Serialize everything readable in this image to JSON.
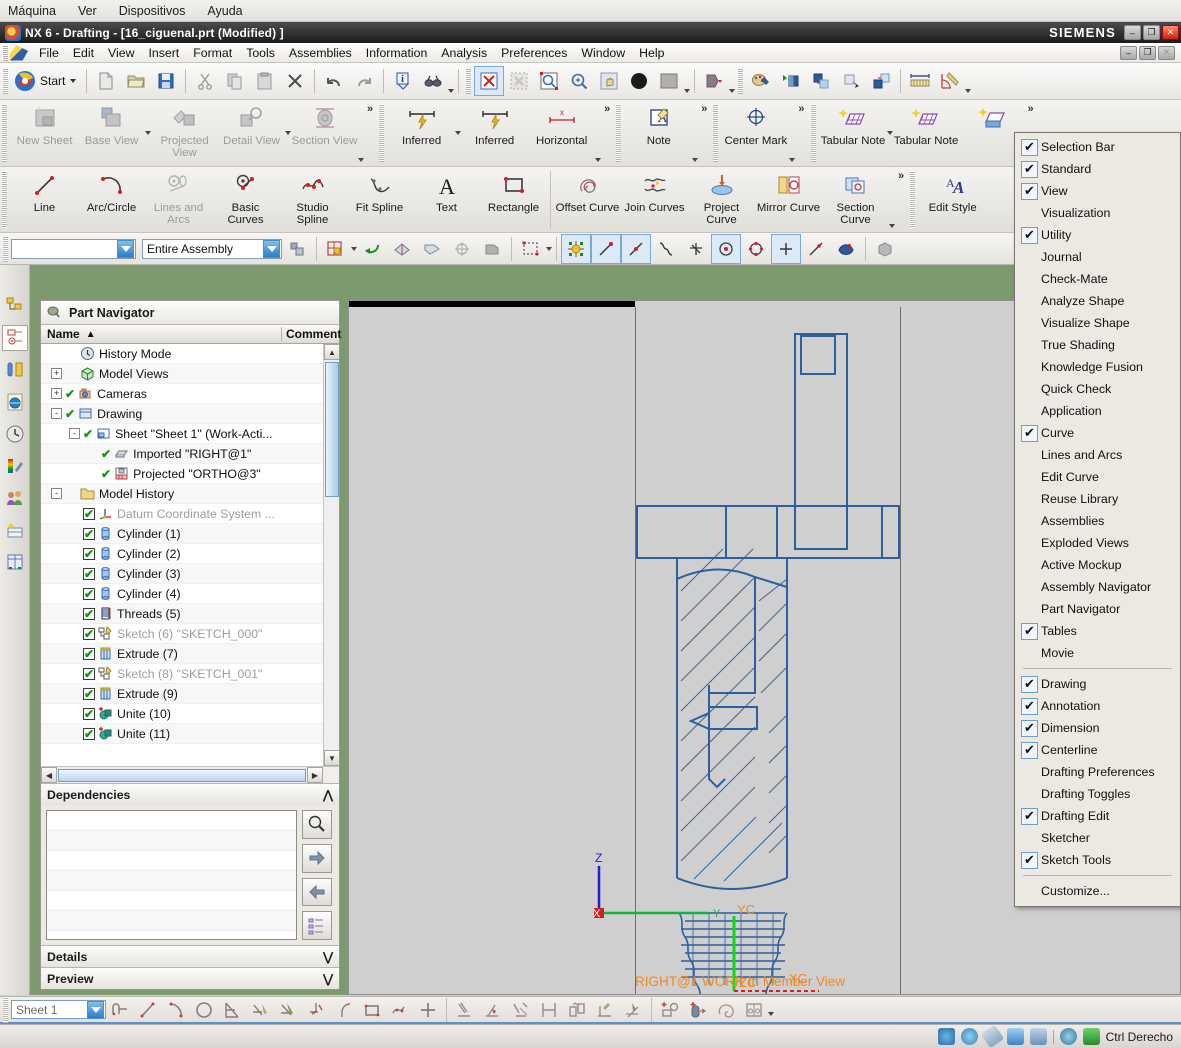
{
  "host": {
    "menus": [
      "Máquina",
      "Ver",
      "Dispositivos",
      "Ayuda"
    ],
    "status_text": "Ctrl Derecho",
    "status_icons": [
      "disk-icon",
      "cd-icon",
      "usb-icon",
      "folder-icon",
      "display-icon",
      "network-icon",
      "download-icon"
    ]
  },
  "window": {
    "title": "NX 6 - Drafting - [16_ciguenal.prt (Modified) ]",
    "brand": "SIEMENS",
    "buttons": {
      "minimize": "–",
      "restore": "❐",
      "close": "✕"
    },
    "doc_buttons": {
      "minimize": "–",
      "restore": "❐",
      "close": "✕"
    }
  },
  "menubar": {
    "items": [
      "File",
      "Edit",
      "View",
      "Insert",
      "Format",
      "Tools",
      "Assemblies",
      "Information",
      "Analysis",
      "Preferences",
      "Window",
      "Help"
    ]
  },
  "standard_toolbar": {
    "start_label": "Start",
    "buttons": [
      "start-button",
      "new-icon",
      "open-icon",
      "save-icon",
      "cut-icon",
      "copy-icon",
      "paste-icon",
      "delete-icon",
      "undo-icon",
      "redo-icon",
      "information-icon",
      "analysis-icon",
      "fit-view-icon",
      "zoom-window-icon",
      "zoom-area-icon",
      "zoom-icon",
      "pan-icon",
      "rotate-icon",
      "shading-icon",
      "hide-icon",
      "palette-icon",
      "layer-visible-icon",
      "layer-settings-icon",
      "move-to-layer-icon",
      "copy-to-layer-icon",
      "linear-dimension-icon",
      "angular-dimension-icon"
    ]
  },
  "ribbon": {
    "drawing_group": [
      {
        "label": "New Sheet",
        "icon": "new-sheet-icon",
        "disabled": true
      },
      {
        "label": "Base View",
        "icon": "base-view-icon",
        "disabled": true
      },
      {
        "label": "Projected View",
        "icon": "projected-view-icon",
        "disabled": true
      },
      {
        "label": "Detail View",
        "icon": "detail-view-icon",
        "disabled": true
      },
      {
        "label": "Section View",
        "icon": "section-view-icon",
        "disabled": true
      }
    ],
    "dimension_group": [
      {
        "label": "Inferred",
        "icon": "inferred-dimension-icon",
        "disabled": false
      },
      {
        "label": "Inferred",
        "icon": "inferred-dimension-icon",
        "disabled": false
      },
      {
        "label": "Horizontal",
        "icon": "horizontal-dimension-icon",
        "disabled": false
      }
    ],
    "annotation_group": [
      {
        "label": "Note",
        "icon": "note-icon",
        "disabled": false
      }
    ],
    "centerline_group": [
      {
        "label": "Center Mark",
        "icon": "center-mark-icon",
        "disabled": false
      }
    ],
    "tables_group": [
      {
        "label": "Tabular Note",
        "icon": "tabular-note-icon",
        "disabled": false
      },
      {
        "label": "Tabular Note",
        "icon": "tabular-note-icon",
        "disabled": false
      },
      {
        "label": "",
        "icon": "table-insert-icon",
        "disabled": false
      }
    ],
    "curve_group": [
      {
        "label": "Line",
        "icon": "line-icon",
        "disabled": false
      },
      {
        "label": "Arc/Circle",
        "icon": "arc-circle-icon",
        "disabled": false
      },
      {
        "label": "Lines and Arcs",
        "icon": "lines-and-arcs-icon",
        "disabled": true
      },
      {
        "label": "Basic Curves",
        "icon": "basic-curves-icon",
        "disabled": false
      },
      {
        "label": "Studio Spline",
        "icon": "studio-spline-icon",
        "disabled": false
      },
      {
        "label": "Fit Spline",
        "icon": "fit-spline-icon",
        "disabled": false
      },
      {
        "label": "Text",
        "icon": "text-icon",
        "disabled": false
      },
      {
        "label": "Rectangle",
        "icon": "rectangle-icon",
        "disabled": false
      }
    ],
    "curve_group2": [
      {
        "label": "Offset Curve",
        "icon": "offset-curve-icon",
        "disabled": false
      },
      {
        "label": "Join Curves",
        "icon": "join-curves-icon",
        "disabled": false
      },
      {
        "label": "Project Curve",
        "icon": "project-curve-icon",
        "disabled": false
      },
      {
        "label": "Mirror Curve",
        "icon": "mirror-curve-icon",
        "disabled": false
      },
      {
        "label": "Section Curve",
        "icon": "section-curve-icon",
        "disabled": false
      }
    ],
    "edit_group": [
      {
        "label": "Edit Style",
        "icon": "edit-style-icon",
        "disabled": false
      }
    ],
    "overflow_symbol": "»"
  },
  "selection_bar": {
    "type_filter_value": "",
    "scope_value": "Entire Assembly",
    "icons": [
      "select-general-icon",
      "snap-point-icon",
      "back-icon",
      "faceted-icon",
      "face-icon",
      "feature-icon",
      "body-icon",
      "rectangle-select-icon",
      "snap-all-icon",
      "end-point-icon",
      "midpoint-icon",
      "control-point-icon",
      "intersection-icon",
      "arc-center-icon",
      "quadrant-icon",
      "existing-point-icon",
      "point-on-curve-icon",
      "point-on-face-icon",
      "bounding-box-icon"
    ]
  },
  "left_strip": {
    "buttons": [
      "assembly-navigator-icon",
      "part-navigator-icon",
      "reuse-library-icon",
      "internet-explorer-icon",
      "history-icon",
      "roles-icon",
      "system-scene-icon",
      "hd3d-tools-icon",
      "web-browser-icon"
    ]
  },
  "part_navigator": {
    "title": "Part Navigator",
    "title_icon": "part-navigator-icon",
    "columns": [
      "Name",
      "Comment"
    ],
    "sort_indicator": "▲",
    "rows": [
      {
        "label": "History Mode",
        "indent": 0,
        "icon": "clock-icon",
        "expander": "",
        "check": "none",
        "grey": false
      },
      {
        "label": "Model Views",
        "indent": 0,
        "icon": "model-views-icon",
        "expander": "+",
        "check": "none",
        "grey": false
      },
      {
        "label": "Cameras",
        "indent": 0,
        "icon": "camera-icon",
        "expander": "+",
        "check": "green",
        "grey": false
      },
      {
        "label": "Drawing",
        "indent": 0,
        "icon": "drawing-icon",
        "expander": "-",
        "check": "green",
        "grey": false
      },
      {
        "label": "Sheet \"Sheet 1\" (Work-Acti...",
        "indent": 1,
        "icon": "sheet-icon",
        "expander": "-",
        "check": "green",
        "grey": false
      },
      {
        "label": "Imported \"RIGHT@1\"",
        "indent": 2,
        "icon": "imported-view-icon",
        "expander": "",
        "check": "green",
        "grey": false
      },
      {
        "label": "Projected \"ORTHO@3\"",
        "indent": 2,
        "icon": "projected-view-icon",
        "expander": "",
        "check": "green",
        "grey": false
      },
      {
        "label": "Model History",
        "indent": 0,
        "icon": "folder-icon",
        "expander": "-",
        "check": "none",
        "grey": false
      },
      {
        "label": "Datum Coordinate System ...",
        "indent": 1,
        "icon": "datum-csys-icon",
        "expander": "",
        "check": "box",
        "grey": true
      },
      {
        "label": "Cylinder (1)",
        "indent": 1,
        "icon": "cylinder-icon",
        "expander": "",
        "check": "box",
        "grey": false
      },
      {
        "label": "Cylinder (2)",
        "indent": 1,
        "icon": "cylinder-icon",
        "expander": "",
        "check": "box",
        "grey": false
      },
      {
        "label": "Cylinder (3)",
        "indent": 1,
        "icon": "cylinder-icon",
        "expander": "",
        "check": "box",
        "grey": false
      },
      {
        "label": "Cylinder (4)",
        "indent": 1,
        "icon": "cylinder-icon",
        "expander": "",
        "check": "box",
        "grey": false
      },
      {
        "label": "Threads (5)",
        "indent": 1,
        "icon": "threads-icon",
        "expander": "",
        "check": "box",
        "grey": false
      },
      {
        "label": "Sketch (6) \"SKETCH_000\"",
        "indent": 1,
        "icon": "sketch-icon",
        "expander": "",
        "check": "box",
        "grey": true
      },
      {
        "label": "Extrude (7)",
        "indent": 1,
        "icon": "extrude-icon",
        "expander": "",
        "check": "box",
        "grey": false
      },
      {
        "label": "Sketch (8) \"SKETCH_001\"",
        "indent": 1,
        "icon": "sketch-icon",
        "expander": "",
        "check": "box",
        "grey": true
      },
      {
        "label": "Extrude (9)",
        "indent": 1,
        "icon": "extrude-icon",
        "expander": "",
        "check": "box",
        "grey": false
      },
      {
        "label": "Unite (10)",
        "indent": 1,
        "icon": "unite-icon",
        "expander": "",
        "check": "box",
        "grey": false
      },
      {
        "label": "Unite (11)",
        "indent": 1,
        "icon": "unite-icon",
        "expander": "",
        "check": "box",
        "grey": false
      }
    ],
    "sections": [
      {
        "title": "Dependencies",
        "state": "expanded",
        "chevron": "⋀"
      },
      {
        "title": "Details",
        "state": "collapsed",
        "chevron": "⋁"
      },
      {
        "title": "Preview",
        "state": "collapsed",
        "chevron": "⋁"
      }
    ],
    "dependency_buttons": [
      "search-icon",
      "forward-arrow-icon",
      "back-arrow-icon",
      "expand-tree-icon"
    ]
  },
  "toolbar_menu": {
    "items": [
      {
        "label": "Selection Bar",
        "checked": true
      },
      {
        "label": "Standard",
        "checked": true
      },
      {
        "label": "View",
        "checked": true
      },
      {
        "label": "Visualization",
        "checked": false
      },
      {
        "label": "Utility",
        "checked": true
      },
      {
        "label": "Journal",
        "checked": false
      },
      {
        "label": "Check-Mate",
        "checked": false
      },
      {
        "label": "Analyze Shape",
        "checked": false
      },
      {
        "label": "Visualize Shape",
        "checked": false
      },
      {
        "label": "True Shading",
        "checked": false
      },
      {
        "label": "Knowledge Fusion",
        "checked": false
      },
      {
        "label": "Quick Check",
        "checked": false
      },
      {
        "label": "Application",
        "checked": false
      },
      {
        "label": "Curve",
        "checked": true
      },
      {
        "label": "Lines and Arcs",
        "checked": false
      },
      {
        "label": "Edit Curve",
        "checked": false
      },
      {
        "label": "Reuse Library",
        "checked": false
      },
      {
        "label": "Assemblies",
        "checked": false
      },
      {
        "label": "Exploded Views",
        "checked": false
      },
      {
        "label": "Active Mockup",
        "checked": false
      },
      {
        "label": "Assembly Navigator",
        "checked": false
      },
      {
        "label": "Part Navigator",
        "checked": false
      },
      {
        "label": "Tables",
        "checked": true
      },
      {
        "label": "Movie",
        "checked": false
      },
      {
        "separator": true
      },
      {
        "label": "Drawing",
        "checked": true
      },
      {
        "label": "Annotation",
        "checked": true
      },
      {
        "label": "Dimension",
        "checked": true
      },
      {
        "label": "Centerline",
        "checked": true
      },
      {
        "label": "Drafting Preferences",
        "checked": false
      },
      {
        "label": "Drafting Toggles",
        "checked": false
      },
      {
        "label": "Drafting Edit",
        "checked": true
      },
      {
        "label": "Sketcher",
        "checked": false
      },
      {
        "label": "Sketch Tools",
        "checked": true
      },
      {
        "separator": true
      },
      {
        "label": "Customize...",
        "checked": false
      }
    ]
  },
  "drawing": {
    "view_label": "RIGHT@1 WORK In Member View",
    "view_label_color": "#f08a1e",
    "geometry_color": "#2c5f9e",
    "background_color": "#cfcfcf",
    "triad": {
      "z_label": "Z",
      "x_label": "X",
      "y_label": "Y",
      "wcs_labels": [
        "XC",
        "YC",
        "ZC"
      ],
      "z_color": "#2020d0",
      "y_color": "#11b341",
      "x_color": "#d02020"
    }
  },
  "bottom_toolbar": {
    "sheet_value": "Sheet 1",
    "icons": [
      "profile-icon",
      "line-icon",
      "arc-icon",
      "circle-icon",
      "quick-trim-icon",
      "quick-extend-icon",
      "make-corner-icon",
      "fillet-icon",
      "chamfer-icon",
      "rectangle-icon",
      "studio-spline-icon",
      "point-icon",
      "constraint-icon",
      "auto-constrain-icon",
      "show-constraints-icon",
      "dimension-icon",
      "alternate-solution-icon",
      "edit-curve-icon",
      "animate-dimension-icon",
      "sketch-plane-icon",
      "new-sketch-icon",
      "extrude-icon",
      "offset-curve-icon",
      "derive-lines-icon"
    ]
  }
}
